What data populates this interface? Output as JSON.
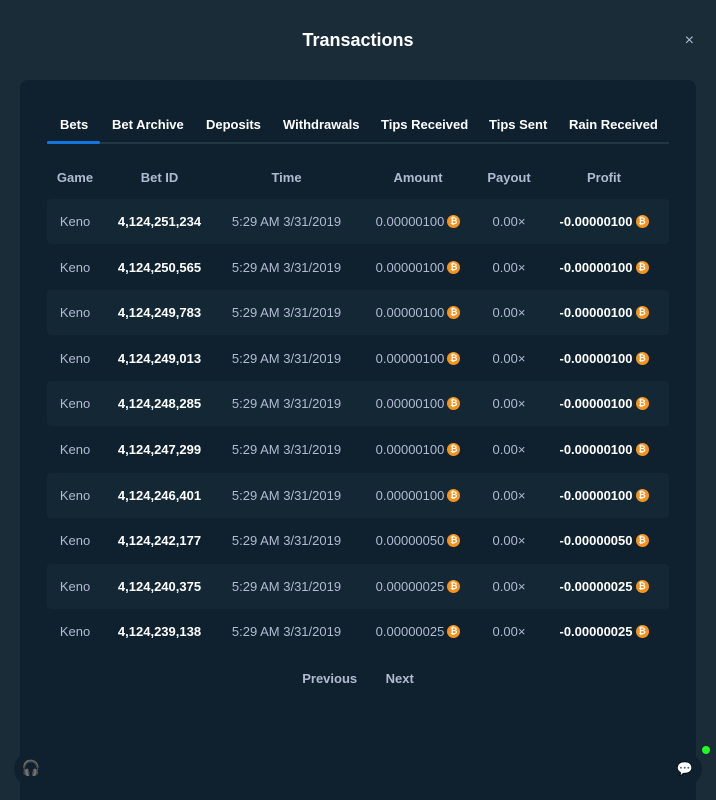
{
  "modal": {
    "title": "Transactions",
    "close_glyph": "×"
  },
  "tabs": [
    {
      "label": "Bets",
      "active": true
    },
    {
      "label": "Bet Archive"
    },
    {
      "label": "Deposits"
    },
    {
      "label": "Withdrawals"
    },
    {
      "label": "Tips Received"
    },
    {
      "label": "Tips Sent"
    },
    {
      "label": "Rain Received"
    }
  ],
  "table": {
    "columns": [
      "Game",
      "Bet ID",
      "Time",
      "Amount",
      "Payout",
      "Profit"
    ],
    "rows": [
      {
        "game": "Keno",
        "bet_id": "4,124,251,234",
        "time": "5:29 AM 3/31/2019",
        "amount": "0.00000100",
        "payout": "0.00×",
        "profit": "-0.00000100"
      },
      {
        "game": "Keno",
        "bet_id": "4,124,250,565",
        "time": "5:29 AM 3/31/2019",
        "amount": "0.00000100",
        "payout": "0.00×",
        "profit": "-0.00000100"
      },
      {
        "game": "Keno",
        "bet_id": "4,124,249,783",
        "time": "5:29 AM 3/31/2019",
        "amount": "0.00000100",
        "payout": "0.00×",
        "profit": "-0.00000100"
      },
      {
        "game": "Keno",
        "bet_id": "4,124,249,013",
        "time": "5:29 AM 3/31/2019",
        "amount": "0.00000100",
        "payout": "0.00×",
        "profit": "-0.00000100"
      },
      {
        "game": "Keno",
        "bet_id": "4,124,248,285",
        "time": "5:29 AM 3/31/2019",
        "amount": "0.00000100",
        "payout": "0.00×",
        "profit": "-0.00000100"
      },
      {
        "game": "Keno",
        "bet_id": "4,124,247,299",
        "time": "5:29 AM 3/31/2019",
        "amount": "0.00000100",
        "payout": "0.00×",
        "profit": "-0.00000100"
      },
      {
        "game": "Keno",
        "bet_id": "4,124,246,401",
        "time": "5:29 AM 3/31/2019",
        "amount": "0.00000100",
        "payout": "0.00×",
        "profit": "-0.00000100"
      },
      {
        "game": "Keno",
        "bet_id": "4,124,242,177",
        "time": "5:29 AM 3/31/2019",
        "amount": "0.00000050",
        "payout": "0.00×",
        "profit": "-0.00000050"
      },
      {
        "game": "Keno",
        "bet_id": "4,124,240,375",
        "time": "5:29 AM 3/31/2019",
        "amount": "0.00000025",
        "payout": "0.00×",
        "profit": "-0.00000025"
      },
      {
        "game": "Keno",
        "bet_id": "4,124,239,138",
        "time": "5:29 AM 3/31/2019",
        "amount": "0.00000025",
        "payout": "0.00×",
        "profit": "-0.00000025"
      }
    ]
  },
  "currency": {
    "icon": "bitcoin-icon",
    "glyph": "₿",
    "color": "#f7931a"
  },
  "pagination": {
    "previous": "Previous",
    "next": "Next"
  },
  "widgets": {
    "support_icon": "headset-icon",
    "chat_icon": "chat-icon",
    "online_color": "#1fff20"
  }
}
